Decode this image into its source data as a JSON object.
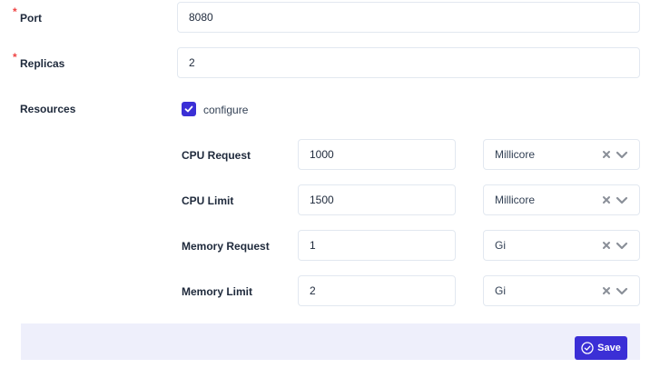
{
  "form": {
    "port": {
      "label": "Port",
      "value": "8080",
      "required_mark": "*"
    },
    "replicas": {
      "label": "Replicas",
      "value": "2",
      "required_mark": "*"
    },
    "resources": {
      "label": "Resources",
      "configure_label": "configure",
      "configure_checked": true,
      "rows": [
        {
          "label": "CPU Request",
          "value": "1000",
          "unit": "Millicore"
        },
        {
          "label": "CPU Limit",
          "value": "1500",
          "unit": "Millicore"
        },
        {
          "label": "Memory Request",
          "value": "1",
          "unit": "Gi"
        },
        {
          "label": "Memory Limit",
          "value": "2",
          "unit": "Gi"
        }
      ]
    }
  },
  "footer": {
    "save_label": "Save"
  },
  "colors": {
    "accent": "#3b2fd6",
    "required": "#ef4444",
    "footer_bg": "#eeeffb",
    "border": "#e2e8f0"
  },
  "icons": {
    "clear": "close-icon",
    "dropdown": "chevron-down-icon",
    "checkbox": "check-icon",
    "save": "check-circle-icon"
  }
}
